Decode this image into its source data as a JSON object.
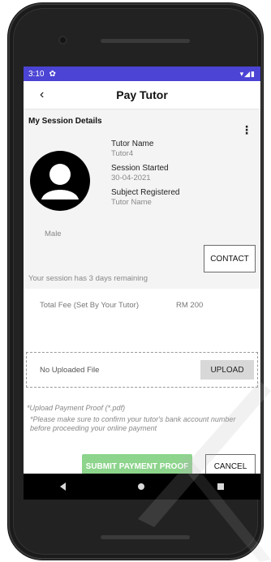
{
  "status_bar": {
    "time": "3:10",
    "settings_icon": "gear-icon",
    "right_icons": "wifi-signal-battery-icons"
  },
  "app_bar": {
    "title": "Pay Tutor",
    "back_icon": "chevron-left-icon"
  },
  "session_card": {
    "title": "My Session Details",
    "menu_icon": "more-vert-icon",
    "gender": "Male",
    "tutor_name_label": "Tutor Name",
    "tutor_name_value": "Tutor4",
    "session_started_label": "Session Started",
    "session_started_value": "30-04-2021",
    "subject_label": "Subject Registered",
    "subject_value": "Tutor Name",
    "contact_label": "CONTACT"
  },
  "remaining_text": "Your session has 3 days remaining",
  "fee": {
    "label": "Total Fee (Set By Your Tutor)",
    "value": "RM 200"
  },
  "upload": {
    "status": "No Uploaded File",
    "button_label": "UPLOAD"
  },
  "proof": {
    "title": "*Upload Payment Proof (*.pdf)",
    "note": "*Please make sure to confirm your tutor's bank account number before proceeding your online payment"
  },
  "actions": {
    "submit_label": "SUBMIT PAYMENT PROOF",
    "cancel_label": "CANCEL"
  },
  "colors": {
    "status_bar": "#4b44d4",
    "submit": "#8dd48d"
  }
}
